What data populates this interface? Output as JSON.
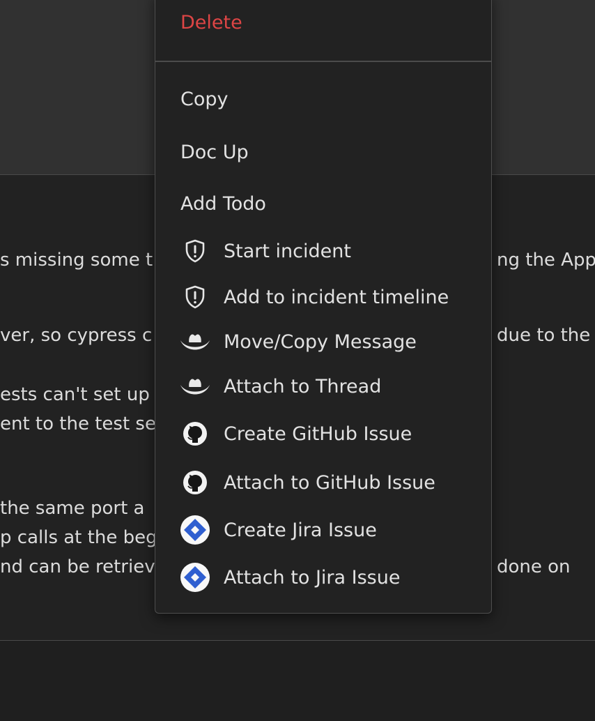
{
  "background_messages": [
    {
      "left": "s missing some t",
      "right": "ng the Apps"
    },
    {
      "left": "ver, so cypress c",
      "right": "due to the"
    },
    {
      "left": "ests can't set up",
      "right": ""
    },
    {
      "left": "ent to the test se",
      "right": ""
    },
    {
      "left": " the same port a",
      "right": ""
    },
    {
      "left": "p calls at the beg",
      "right": ""
    },
    {
      "left": "nd can be retriev",
      "right": "done on"
    }
  ],
  "menu": {
    "delete_label": "Delete",
    "items": [
      {
        "label": "Copy",
        "icon": ""
      },
      {
        "label": "Doc Up",
        "icon": ""
      },
      {
        "label": "Add Todo",
        "icon": ""
      },
      {
        "label": "Start incident",
        "icon": "shield-alert-icon"
      },
      {
        "label": "Add to incident timeline",
        "icon": "shield-alert-icon"
      },
      {
        "label": "Move/Copy Message",
        "icon": "cowboy-hat-icon"
      },
      {
        "label": "Attach to Thread",
        "icon": "cowboy-hat-icon"
      },
      {
        "label": "Create GitHub Issue",
        "icon": "github-icon"
      },
      {
        "label": "Attach to GitHub Issue",
        "icon": "github-icon"
      },
      {
        "label": "Create Jira Issue",
        "icon": "jira-icon"
      },
      {
        "label": "Attach to Jira Issue",
        "icon": "jira-icon"
      }
    ]
  },
  "colors": {
    "danger": "#dd4545",
    "menu_background": "#222222",
    "jira_blue": "#2f5fd0"
  }
}
